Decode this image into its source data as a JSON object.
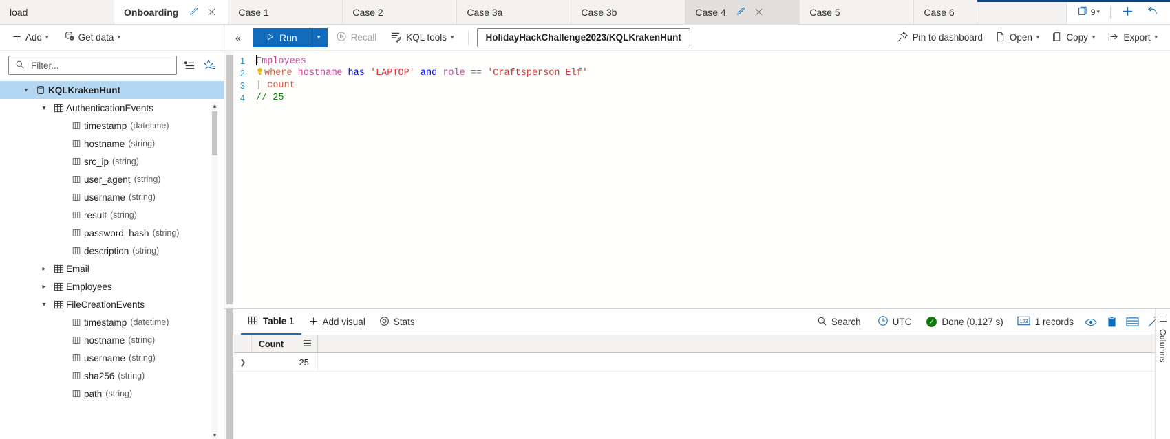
{
  "tabs": [
    {
      "label": "load",
      "state": "plain"
    },
    {
      "label": "Onboarding",
      "state": "active-white",
      "has_edit": true,
      "has_close": true
    },
    {
      "label": "Case 1",
      "state": "plain"
    },
    {
      "label": "Case 2",
      "state": "plain"
    },
    {
      "label": "Case 3a",
      "state": "plain"
    },
    {
      "label": "Case 3b",
      "state": "plain"
    },
    {
      "label": "Case 4",
      "state": "active-grey",
      "has_edit": true,
      "has_close": true
    },
    {
      "label": "Case 5",
      "state": "plain"
    },
    {
      "label": "Case 6",
      "state": "plain"
    }
  ],
  "tabstrip_right": {
    "tab_count": "9",
    "copy_tabs_icon": "copy-tabs-icon",
    "new_tab_icon": "plus-icon",
    "undo_icon": "undo-icon"
  },
  "sidebar": {
    "add_label": "Add",
    "get_data_label": "Get data",
    "filter_placeholder": "Filter...",
    "filter_value": "",
    "toggle_icon": "detail-list-icon",
    "favorite_icon": "favorite-star-icon",
    "tree": [
      {
        "level": 0,
        "twist": "down",
        "icon": "database-icon",
        "label": "KQLKrakenHunt",
        "type": "",
        "selected": true,
        "bold": true
      },
      {
        "level": 1,
        "twist": "down",
        "icon": "table-icon",
        "label": "AuthenticationEvents",
        "type": ""
      },
      {
        "level": 2,
        "twist": "none",
        "icon": "column-icon",
        "label": "timestamp",
        "type": "(datetime)"
      },
      {
        "level": 2,
        "twist": "none",
        "icon": "column-icon",
        "label": "hostname",
        "type": "(string)"
      },
      {
        "level": 2,
        "twist": "none",
        "icon": "column-icon",
        "label": "src_ip",
        "type": "(string)"
      },
      {
        "level": 2,
        "twist": "none",
        "icon": "column-icon",
        "label": "user_agent",
        "type": "(string)"
      },
      {
        "level": 2,
        "twist": "none",
        "icon": "column-icon",
        "label": "username",
        "type": "(string)"
      },
      {
        "level": 2,
        "twist": "none",
        "icon": "column-icon",
        "label": "result",
        "type": "(string)"
      },
      {
        "level": 2,
        "twist": "none",
        "icon": "column-icon",
        "label": "password_hash",
        "type": "(string)"
      },
      {
        "level": 2,
        "twist": "none",
        "icon": "column-icon",
        "label": "description",
        "type": "(string)"
      },
      {
        "level": 1,
        "twist": "right",
        "icon": "table-icon",
        "label": "Email",
        "type": ""
      },
      {
        "level": 1,
        "twist": "right",
        "icon": "table-icon",
        "label": "Employees",
        "type": ""
      },
      {
        "level": 1,
        "twist": "down",
        "icon": "table-icon",
        "label": "FileCreationEvents",
        "type": ""
      },
      {
        "level": 2,
        "twist": "none",
        "icon": "column-icon",
        "label": "timestamp",
        "type": "(datetime)"
      },
      {
        "level": 2,
        "twist": "none",
        "icon": "column-icon",
        "label": "hostname",
        "type": "(string)"
      },
      {
        "level": 2,
        "twist": "none",
        "icon": "column-icon",
        "label": "username",
        "type": "(string)"
      },
      {
        "level": 2,
        "twist": "none",
        "icon": "column-icon",
        "label": "sha256",
        "type": "(string)"
      },
      {
        "level": 2,
        "twist": "none",
        "icon": "column-icon",
        "label": "path",
        "type": "(string)"
      }
    ]
  },
  "query_toolbar": {
    "collapse_icon": "collapse-left-icon",
    "run_label": "Run",
    "run_split_icon": "chevron-down-icon",
    "recall_label": "Recall",
    "kql_tools_label": "KQL tools",
    "database_pill": "HolidayHackChallenge2023/KQLKrakenHunt",
    "pin_label": "Pin to dashboard",
    "open_label": "Open",
    "copy_label": "Copy",
    "export_label": "Export"
  },
  "editor": {
    "lines": [
      {
        "num": "1",
        "text": "Employees"
      },
      {
        "num": "2",
        "text": "| where hostname has 'LAPTOP' and role == 'Craftsperson Elf'"
      },
      {
        "num": "3",
        "text": "| count"
      },
      {
        "num": "4",
        "text": "// 25"
      }
    ]
  },
  "results": {
    "table_tab": "Table 1",
    "add_visual_label": "Add visual",
    "stats_label": "Stats",
    "search_label": "Search",
    "timezone_label": "UTC",
    "status_label": "Done (0.127 s)",
    "records_label": "1 records",
    "columns_rail_label": "Columns",
    "grid": {
      "columns": [
        "Count"
      ],
      "rows": [
        [
          "25"
        ]
      ]
    }
  },
  "colors": {
    "accent": "#0f6cbd",
    "titlebar": "#13437e",
    "selection": "#b3d7f2",
    "success": "#107c10"
  }
}
